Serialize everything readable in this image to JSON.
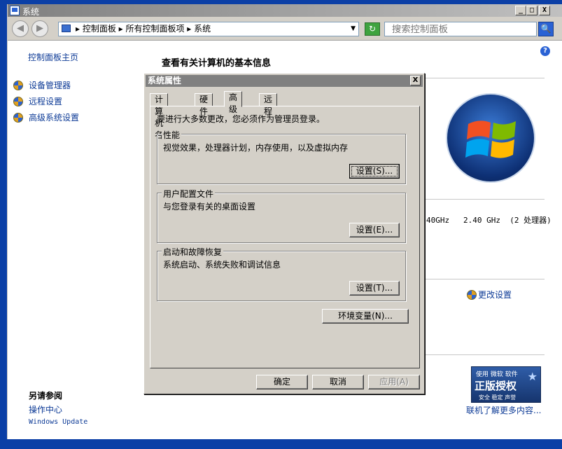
{
  "window": {
    "title": "系统"
  },
  "titlebar": {
    "minimize": "_",
    "maximize": "□",
    "close": "X"
  },
  "nav": {
    "back": "◀",
    "forward": "▶",
    "breadcrumb": "▸ 控制面板 ▸ 所有控制面板项 ▸ 系统",
    "dropdown": "▼",
    "go": "↻",
    "search_placeholder": "搜索控制面板",
    "search_button": "🔍"
  },
  "left_panel": {
    "home": "控制面板主页",
    "items": [
      {
        "label": "设备管理器"
      },
      {
        "label": "远程设置"
      },
      {
        "label": "高级系统设置"
      }
    ],
    "see_also_title": "另请参阅",
    "see_also": [
      {
        "label": "操作中心"
      },
      {
        "label": "Windows Update"
      }
    ]
  },
  "main": {
    "heading": "查看有关计算机的基本信息",
    "processor_spec": "40GHz   2.40 GHz  (2 处理器)",
    "change_settings": "更改设置",
    "learn_more": "联机了解更多内容...",
    "help": "?",
    "genuine": {
      "line1": "使用 微软 软件",
      "line2": "正版授权",
      "line3": "安全 稳定 声誉",
      "star": "★"
    }
  },
  "dialog": {
    "title": "系统属性",
    "close": "X",
    "tabs": [
      {
        "label": "计算机名"
      },
      {
        "label": "硬件"
      },
      {
        "label": "高级"
      },
      {
        "label": "远程"
      }
    ],
    "note": "要进行大多数更改，您必须作为管理员登录。",
    "groups": [
      {
        "title": "性能",
        "desc": "视觉效果，处理器计划，内存使用，以及虚拟内存",
        "button": "设置(S)..."
      },
      {
        "title": "用户配置文件",
        "desc": "与您登录有关的桌面设置",
        "button": "设置(E)..."
      },
      {
        "title": "启动和故障恢复",
        "desc": "系统启动、系统失败和调试信息",
        "button": "设置(T)..."
      }
    ],
    "env_button": "环境变量(N)...",
    "ok": "确定",
    "cancel": "取消",
    "apply": "应用(A)"
  }
}
